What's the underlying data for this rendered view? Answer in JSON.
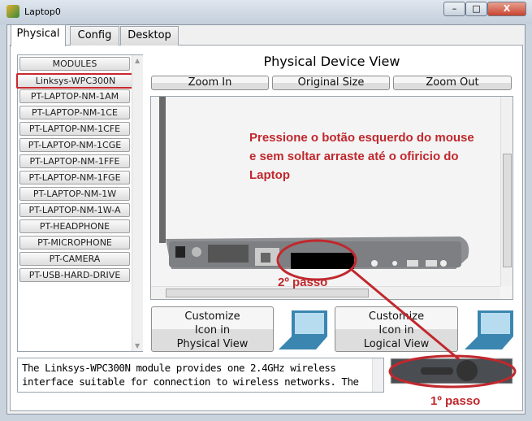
{
  "window": {
    "title": "Laptop0",
    "minimize": "–",
    "maximize": "□",
    "close": "X"
  },
  "tabs": [
    {
      "label": "Physical",
      "active": true
    },
    {
      "label": "Config"
    },
    {
      "label": "Desktop"
    }
  ],
  "modules": {
    "header": "MODULES",
    "items": [
      "Linksys-WPC300N",
      "PT-LAPTOP-NM-1AM",
      "PT-LAPTOP-NM-1CE",
      "PT-LAPTOP-NM-1CFE",
      "PT-LAPTOP-NM-1CGE",
      "PT-LAPTOP-NM-1FFE",
      "PT-LAPTOP-NM-1FGE",
      "PT-LAPTOP-NM-1W",
      "PT-LAPTOP-NM-1W-A",
      "PT-HEADPHONE",
      "PT-MICROPHONE",
      "PT-CAMERA",
      "PT-USB-HARD-DRIVE"
    ],
    "selected": "Linksys-WPC300N"
  },
  "view": {
    "title": "Physical Device View",
    "zoom_in": "Zoom In",
    "original_size": "Original Size",
    "zoom_out": "Zoom Out"
  },
  "annotations": {
    "instruction": "Pressione o botão esquerdo do mouse e sem soltar arraste até o ofiricio do Laptop",
    "step1": "1º passo",
    "step2": "2º passo",
    "color": "#c0282d"
  },
  "customize": {
    "physical": [
      "Customize",
      "Icon in",
      "Physical View"
    ],
    "logical": [
      "Customize",
      "Icon in",
      "Logical View"
    ]
  },
  "description": "The Linksys-WPC300N module provides one 2.4GHz wireless interface suitable for connection to wireless networks. The"
}
